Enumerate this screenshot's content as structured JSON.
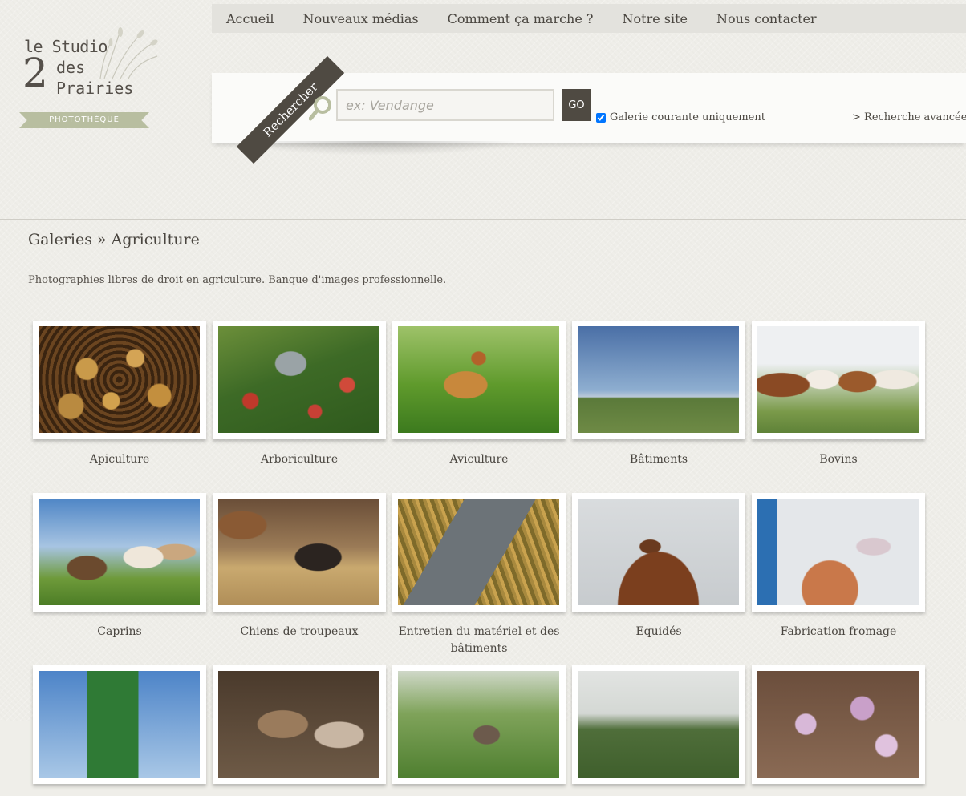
{
  "logo": {
    "line1": "le Studio",
    "digit": "2",
    "line2": "des",
    "line3": "Prairies",
    "ribbon": "PHOTOTHÈQUE"
  },
  "nav": [
    "Accueil",
    "Nouveaux médias",
    "Comment ça marche ?",
    "Notre site",
    "Nous contacter"
  ],
  "search": {
    "tag": "Rechercher",
    "placeholder": "ex: Vendange",
    "value": "",
    "go_label": "GO",
    "checkbox_label": "Galerie courante uniquement",
    "checkbox_checked": true,
    "advanced_label": "> Recherche avancée"
  },
  "breadcrumb": {
    "text": "Galeries » Agriculture"
  },
  "description": "Photographies libres de droit en agriculture. Banque d'images professionnelle.",
  "galleries": [
    {
      "label": "Apiculture",
      "icon": "bees-photo"
    },
    {
      "label": "Arboriculture",
      "icon": "orchard-photo"
    },
    {
      "label": "Aviculture",
      "icon": "hen-photo"
    },
    {
      "label": "Bâtiments",
      "icon": "farm-building-photo"
    },
    {
      "label": "Bovins",
      "icon": "cows-photo"
    },
    {
      "label": "Caprins",
      "icon": "goats-photo"
    },
    {
      "label": "Chiens de troupeaux",
      "icon": "dog-photo"
    },
    {
      "label": "Entretien du matériel et des bâtiments",
      "icon": "toolbox-photo"
    },
    {
      "label": "Equidés",
      "icon": "horse-photo"
    },
    {
      "label": "Fabrication fromage",
      "icon": "cheese-making-photo"
    },
    {
      "label": "",
      "icon": "tractor-photo"
    },
    {
      "label": "",
      "icon": "rabbits-photo"
    },
    {
      "label": "",
      "icon": "market-garden-photo"
    },
    {
      "label": "",
      "icon": "countryside-photo"
    },
    {
      "label": "",
      "icon": "flowers-photo"
    }
  ],
  "colors": {
    "accent": "#4f4a42",
    "background": "#efeee9",
    "ribbon": "#b8bea0"
  }
}
